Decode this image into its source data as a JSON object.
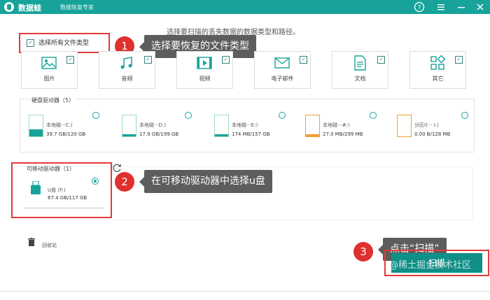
{
  "titlebar": {
    "app_name": "数据蛙",
    "subtitle": "数据恢复专家",
    "help_icon": "help-icon",
    "menu_icon": "menu-icon",
    "min_icon": "minimize-icon",
    "close_icon": "close-icon",
    "bg_color": "#17a39a"
  },
  "hint": "选择要扫描的丢失数据的数据类型和路径。",
  "select_all": {
    "label": "选择所有文件类型",
    "checked": true
  },
  "callouts": {
    "c1": {
      "badge": "1",
      "text": "选择要恢复的文件类型"
    },
    "c2": {
      "badge": "2",
      "text": "在可移动驱动器中选择u盘"
    },
    "c3": {
      "badge": "3",
      "text": "点击“扫描”"
    }
  },
  "file_types": [
    {
      "label": "图片",
      "icon": "image-icon",
      "checked": true
    },
    {
      "label": "音频",
      "icon": "music-icon",
      "checked": true
    },
    {
      "label": "视频",
      "icon": "video-icon",
      "checked": true
    },
    {
      "label": "电子邮件",
      "icon": "mail-icon",
      "checked": true
    },
    {
      "label": "文档",
      "icon": "document-icon",
      "checked": true
    },
    {
      "label": "其它",
      "icon": "other-icon",
      "checked": true
    }
  ],
  "hard_drives": {
    "title": "硬盘驱动器（5）",
    "items": [
      {
        "name": "本地磁···C:)",
        "size": "39.7 GB/120 GB",
        "usage": 0.33,
        "color": "#17a39a"
      },
      {
        "name": "本地磁···D:)",
        "size": "17.9 GB/199 GB",
        "usage": 0.09,
        "color": "#17a39a"
      },
      {
        "name": "本地磁···E:)",
        "size": "174 MB/157 GB",
        "usage": 0.01,
        "color": "#17a39a"
      },
      {
        "name": "本地磁···#:)",
        "size": "27.0 MB/299 MB",
        "usage": 0.09,
        "color": "#f0a030"
      },
      {
        "name": "分区I(··· I:)",
        "size": "0.00  B/128 MB",
        "usage": 0.0,
        "color": "#f0a030"
      }
    ]
  },
  "removable": {
    "title": "可移动驱动器（1）",
    "usb_name": "U盘 (F:)",
    "usb_size": "67.4 GB/117 GB",
    "selected": true,
    "refresh_icon": "refresh-icon"
  },
  "recycle": {
    "label": "回收站",
    "icon": "trash-icon"
  },
  "scan_button": {
    "label": "扫描",
    "watermark": "@稀土掘金技术社区"
  }
}
